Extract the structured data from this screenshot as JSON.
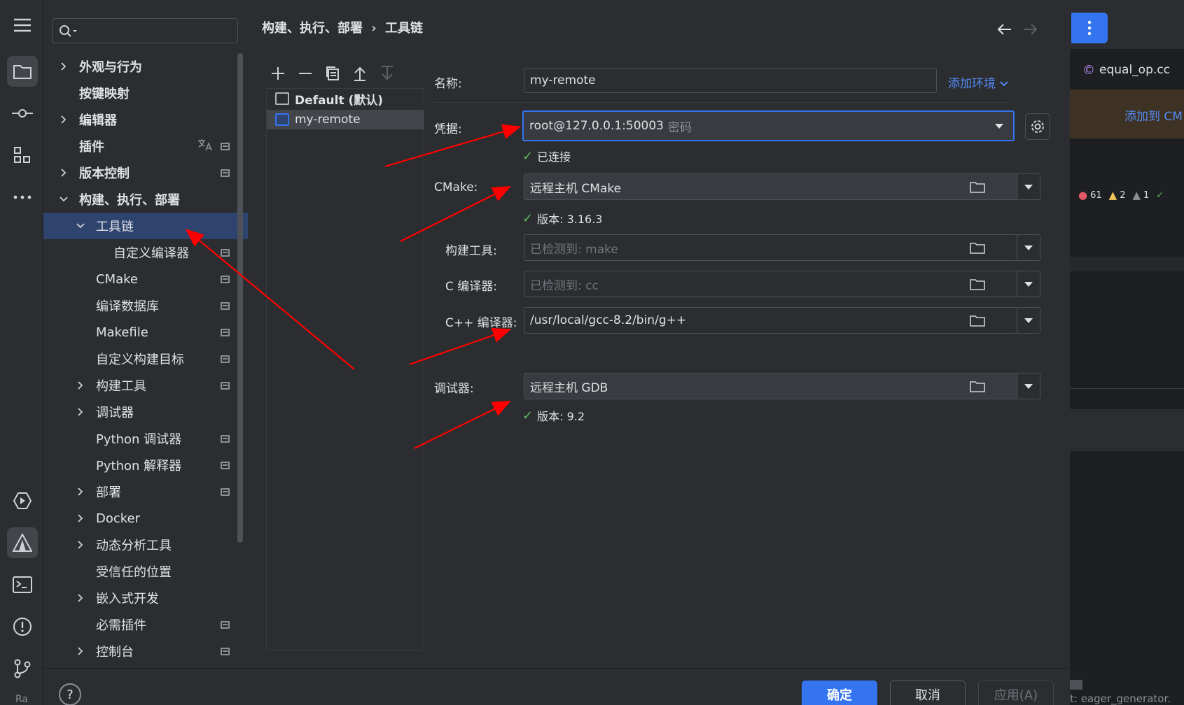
{
  "activity_bar": {
    "icons": [
      "menu-icon",
      "folder-icon",
      "commit-icon",
      "structure-icon",
      "more-icon",
      "run-icon",
      "cmake-icon",
      "terminal-icon",
      "problems-icon",
      "git-icon"
    ]
  },
  "sidebar": {
    "search_placeholder": "",
    "items": [
      {
        "label": "外观与行为",
        "level": 0,
        "expander": "collapsed",
        "bold": true,
        "badge": false
      },
      {
        "label": "按键映射",
        "level": 0,
        "expander": "none",
        "bold": true,
        "badge": false
      },
      {
        "label": "编辑器",
        "level": 0,
        "expander": "collapsed",
        "bold": true,
        "badge": false
      },
      {
        "label": "插件",
        "level": 0,
        "expander": "none",
        "bold": true,
        "badge": true
      },
      {
        "label": "版本控制",
        "level": 0,
        "expander": "collapsed",
        "bold": true,
        "badge": true
      },
      {
        "label": "构建、执行、部署",
        "level": 0,
        "expander": "expanded",
        "bold": true,
        "badge": false
      },
      {
        "label": "工具链",
        "level": 1,
        "expander": "expanded",
        "bold": false,
        "badge": false,
        "selected": true
      },
      {
        "label": "自定义编译器",
        "level": 2,
        "expander": "none",
        "bold": false,
        "badge": true
      },
      {
        "label": "CMake",
        "level": 1,
        "expander": "none",
        "bold": false,
        "badge": true
      },
      {
        "label": "编译数据库",
        "level": 1,
        "expander": "none",
        "bold": false,
        "badge": true
      },
      {
        "label": "Makefile",
        "level": 1,
        "expander": "none",
        "bold": false,
        "badge": true
      },
      {
        "label": "自定义构建目标",
        "level": 1,
        "expander": "none",
        "bold": false,
        "badge": true
      },
      {
        "label": "构建工具",
        "level": 1,
        "expander": "collapsed",
        "bold": false,
        "badge": true
      },
      {
        "label": "调试器",
        "level": 1,
        "expander": "collapsed",
        "bold": false,
        "badge": false
      },
      {
        "label": "Python 调试器",
        "level": 1,
        "expander": "none",
        "bold": false,
        "badge": true
      },
      {
        "label": "Python 解释器",
        "level": 1,
        "expander": "none",
        "bold": false,
        "badge": true
      },
      {
        "label": "部署",
        "level": 1,
        "expander": "collapsed",
        "bold": false,
        "badge": true
      },
      {
        "label": "Docker",
        "level": 1,
        "expander": "collapsed",
        "bold": false,
        "badge": false
      },
      {
        "label": "动态分析工具",
        "level": 1,
        "expander": "collapsed",
        "bold": false,
        "badge": false
      },
      {
        "label": "受信任的位置",
        "level": 1,
        "expander": "none",
        "bold": false,
        "badge": false
      },
      {
        "label": "嵌入式开发",
        "level": 1,
        "expander": "collapsed",
        "bold": false,
        "badge": false
      },
      {
        "label": "必需插件",
        "level": 1,
        "expander": "none",
        "bold": false,
        "badge": true
      },
      {
        "label": "控制台",
        "level": 1,
        "expander": "collapsed",
        "bold": false,
        "badge": true
      }
    ]
  },
  "breadcrumb": {
    "parent": "构建、执行、部署",
    "separator": "›",
    "current": "工具链"
  },
  "toolchains": {
    "items": [
      {
        "label": "Default (默认)",
        "bold": true
      },
      {
        "label": "my-remote",
        "bold": false
      }
    ]
  },
  "form": {
    "name_label": "名称:",
    "name_value": "my-remote",
    "add_env_label": "添加环境",
    "credentials_label": "凭据:",
    "credentials_value": "root@127.0.0.1:50003",
    "credentials_hint": "密码",
    "credentials_status": "已连接",
    "cmake_label": "CMake:",
    "cmake_value": "远程主机 CMake",
    "cmake_status": "版本: 3.16.3",
    "build_tool_label": "构建工具:",
    "build_tool_placeholder": "已检测到: make",
    "c_compiler_label": "C 编译器:",
    "c_compiler_placeholder": "已检测到: cc",
    "cpp_compiler_label": "C++ 编译器:",
    "cpp_compiler_value": "/usr/local/gcc-8.2/bin/g++",
    "debugger_label": "调试器:",
    "debugger_value": "远程主机 GDB",
    "debugger_status": "版本: 9.2"
  },
  "footer": {
    "help_label": "?",
    "ok_label": "确定",
    "cancel_label": "取消",
    "apply_label": "应用(A)"
  },
  "editor": {
    "tab_label": "equal_op.cc",
    "banner_link": "添加到 CM",
    "errors": "61",
    "warnings": "2",
    "weak_warnings": "1",
    "bottom_text": "t: eager_generator.",
    "left_bottom_text": "Ra"
  },
  "colors": {
    "accent": "#3574f0",
    "arrow": "#ff0000",
    "success": "#5fb865",
    "selection": "#2e436e"
  }
}
